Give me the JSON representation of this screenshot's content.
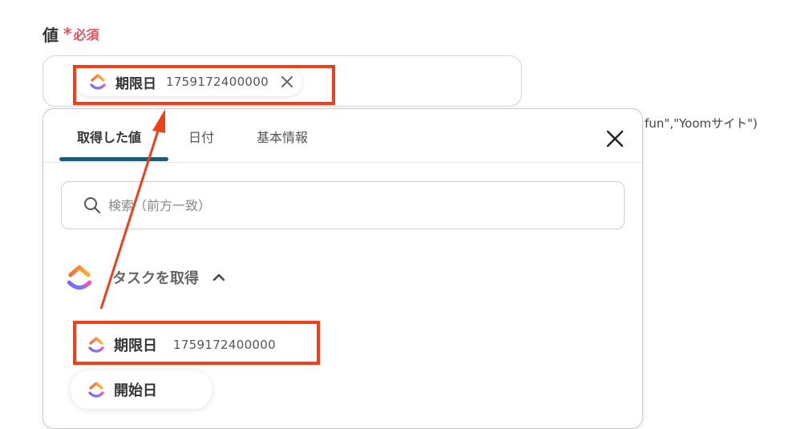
{
  "field": {
    "label": "値",
    "required_mark": "*",
    "required_text": "必須"
  },
  "selected_chip": {
    "name": "期限日",
    "value": "1759172400000",
    "icon": "clickup-logo-icon"
  },
  "background_text": "fun\",\"Yoomサイト\")",
  "popup": {
    "tabs": [
      {
        "label": "取得した値",
        "active": true
      },
      {
        "label": "日付",
        "active": false
      },
      {
        "label": "基本情報",
        "active": false
      }
    ],
    "search": {
      "placeholder": "検索（前方一致）"
    },
    "group": {
      "name": "タスクを取得",
      "expanded": true
    },
    "items": [
      {
        "name": "期限日",
        "value": "1759172400000"
      },
      {
        "name": "開始日",
        "value": ""
      }
    ]
  },
  "colors": {
    "highlight": "#f0401a",
    "tab_underline": "#1a5b78",
    "required": "#e8505b"
  }
}
